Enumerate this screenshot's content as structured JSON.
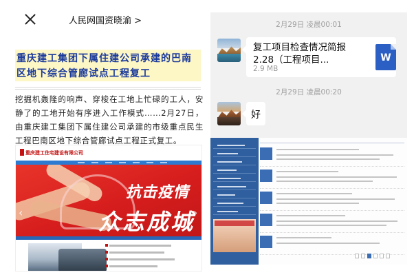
{
  "article": {
    "header_title": "人民网国资晓渝 >",
    "headline": "重庆建工集团下属住建公司承建的巴南区地下综合管廊试点工程复工",
    "body": "挖掘机轰隆的响声、穿梭在工地上忙碌的工人，安静了的工地开始有序进入工作模式……2月27日，由重庆建工集团下属住建公司承建的市级重点民生工程巴南区地下综合管廊试点工程正式复工。",
    "site_banner": {
      "logo": "重庆建工住宅建设有限公司",
      "line1": "抗击疫情",
      "line2": "众志成城"
    }
  },
  "chat": {
    "messages": [
      {
        "timestamp": "2月29日 凌晨00:01",
        "type": "file",
        "file_name": "复工项目检查情况简报 2.28（工程项目...",
        "file_size": "2.9 MB",
        "file_icon": "word-icon",
        "file_icon_letter": "W"
      },
      {
        "timestamp": "2月29日 凌晨00:20",
        "type": "text",
        "text": "好"
      }
    ]
  }
}
